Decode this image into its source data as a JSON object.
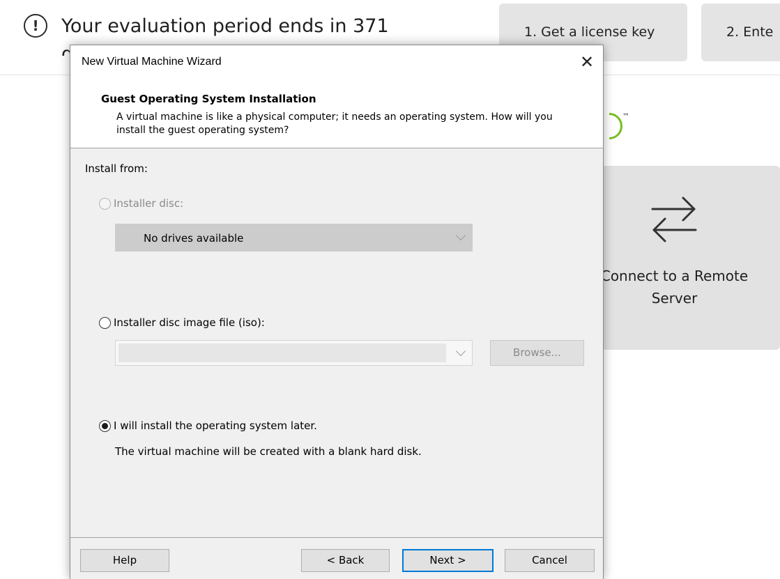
{
  "background": {
    "eval_text": "Your evaluation period ends in 371",
    "eval_text_cont": "d",
    "step1_label": "1. Get a license key",
    "step2_label": "2. Ente",
    "remote_label": "Connect to a Remote Server",
    "tm": "™"
  },
  "wizard": {
    "title": "New Virtual Machine Wizard",
    "close_glyph": "✕",
    "header_title": "Guest Operating System Installation",
    "header_desc": "A virtual machine is like a physical computer; it needs an operating system. How will you install the guest operating system?",
    "install_from_label": "Install from:",
    "options": {
      "disc_label": "Installer disc:",
      "disc_selected": "No drives available",
      "iso_label": "Installer disc image file (iso):",
      "iso_value": "",
      "later_label": "I will install the operating system later.",
      "later_note": "The virtual machine will be created with a blank hard disk.",
      "selected": "later"
    },
    "browse_label": "Browse...",
    "buttons": {
      "help": "Help",
      "back": "< Back",
      "next": "Next >",
      "cancel": "Cancel"
    }
  },
  "colors": {
    "focus_border": "#0078d7",
    "logo_green": "#78be20",
    "disabled_text": "#8a8a8a"
  },
  "icons": [
    "alert-icon",
    "close-icon",
    "swap-arrows-icon",
    "chevron-down-icon"
  ]
}
